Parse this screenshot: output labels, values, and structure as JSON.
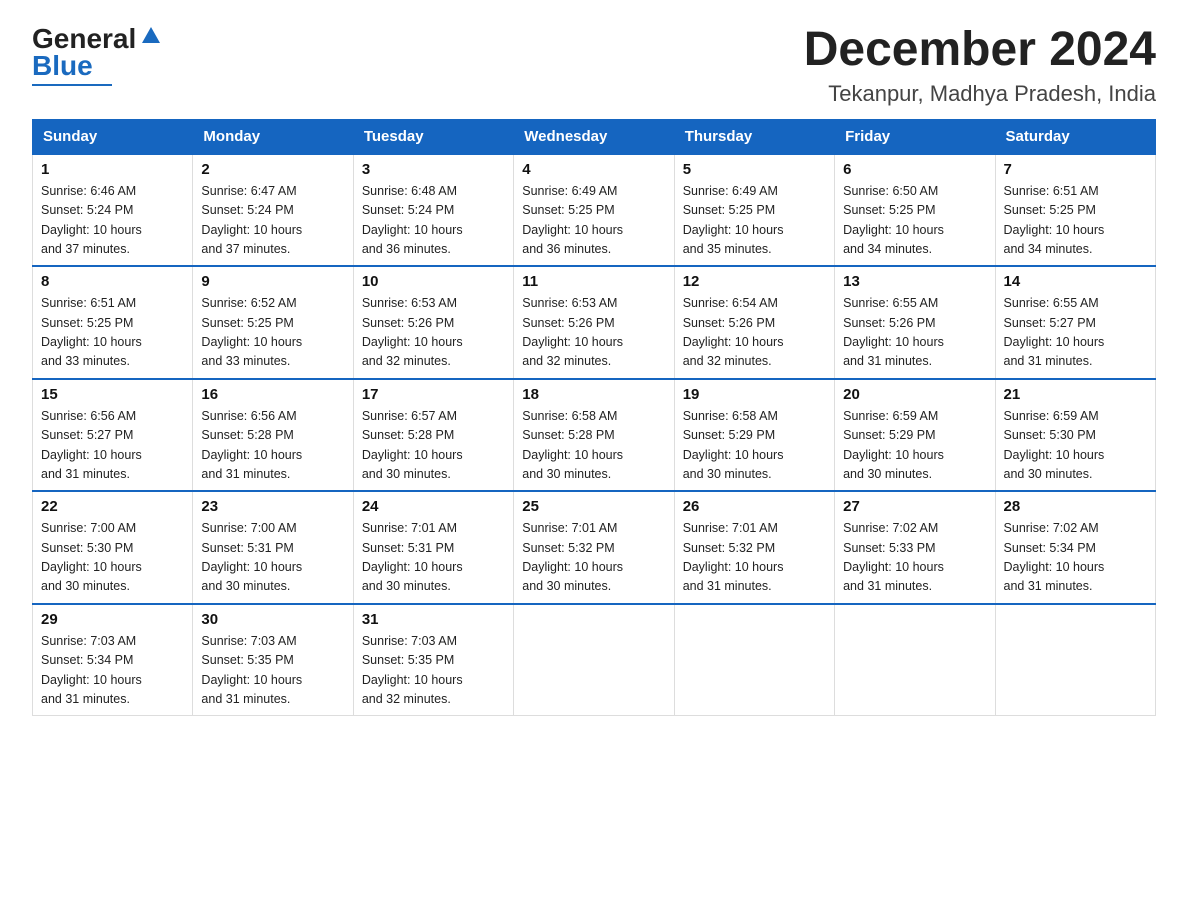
{
  "header": {
    "logo_general": "General",
    "logo_blue": "Blue",
    "title": "December 2024",
    "subtitle": "Tekanpur, Madhya Pradesh, India"
  },
  "days_of_week": [
    "Sunday",
    "Monday",
    "Tuesday",
    "Wednesday",
    "Thursday",
    "Friday",
    "Saturday"
  ],
  "weeks": [
    [
      {
        "day": "1",
        "sunrise": "6:46 AM",
        "sunset": "5:24 PM",
        "daylight": "10 hours and 37 minutes."
      },
      {
        "day": "2",
        "sunrise": "6:47 AM",
        "sunset": "5:24 PM",
        "daylight": "10 hours and 37 minutes."
      },
      {
        "day": "3",
        "sunrise": "6:48 AM",
        "sunset": "5:24 PM",
        "daylight": "10 hours and 36 minutes."
      },
      {
        "day": "4",
        "sunrise": "6:49 AM",
        "sunset": "5:25 PM",
        "daylight": "10 hours and 36 minutes."
      },
      {
        "day": "5",
        "sunrise": "6:49 AM",
        "sunset": "5:25 PM",
        "daylight": "10 hours and 35 minutes."
      },
      {
        "day": "6",
        "sunrise": "6:50 AM",
        "sunset": "5:25 PM",
        "daylight": "10 hours and 34 minutes."
      },
      {
        "day": "7",
        "sunrise": "6:51 AM",
        "sunset": "5:25 PM",
        "daylight": "10 hours and 34 minutes."
      }
    ],
    [
      {
        "day": "8",
        "sunrise": "6:51 AM",
        "sunset": "5:25 PM",
        "daylight": "10 hours and 33 minutes."
      },
      {
        "day": "9",
        "sunrise": "6:52 AM",
        "sunset": "5:25 PM",
        "daylight": "10 hours and 33 minutes."
      },
      {
        "day": "10",
        "sunrise": "6:53 AM",
        "sunset": "5:26 PM",
        "daylight": "10 hours and 32 minutes."
      },
      {
        "day": "11",
        "sunrise": "6:53 AM",
        "sunset": "5:26 PM",
        "daylight": "10 hours and 32 minutes."
      },
      {
        "day": "12",
        "sunrise": "6:54 AM",
        "sunset": "5:26 PM",
        "daylight": "10 hours and 32 minutes."
      },
      {
        "day": "13",
        "sunrise": "6:55 AM",
        "sunset": "5:26 PM",
        "daylight": "10 hours and 31 minutes."
      },
      {
        "day": "14",
        "sunrise": "6:55 AM",
        "sunset": "5:27 PM",
        "daylight": "10 hours and 31 minutes."
      }
    ],
    [
      {
        "day": "15",
        "sunrise": "6:56 AM",
        "sunset": "5:27 PM",
        "daylight": "10 hours and 31 minutes."
      },
      {
        "day": "16",
        "sunrise": "6:56 AM",
        "sunset": "5:28 PM",
        "daylight": "10 hours and 31 minutes."
      },
      {
        "day": "17",
        "sunrise": "6:57 AM",
        "sunset": "5:28 PM",
        "daylight": "10 hours and 30 minutes."
      },
      {
        "day": "18",
        "sunrise": "6:58 AM",
        "sunset": "5:28 PM",
        "daylight": "10 hours and 30 minutes."
      },
      {
        "day": "19",
        "sunrise": "6:58 AM",
        "sunset": "5:29 PM",
        "daylight": "10 hours and 30 minutes."
      },
      {
        "day": "20",
        "sunrise": "6:59 AM",
        "sunset": "5:29 PM",
        "daylight": "10 hours and 30 minutes."
      },
      {
        "day": "21",
        "sunrise": "6:59 AM",
        "sunset": "5:30 PM",
        "daylight": "10 hours and 30 minutes."
      }
    ],
    [
      {
        "day": "22",
        "sunrise": "7:00 AM",
        "sunset": "5:30 PM",
        "daylight": "10 hours and 30 minutes."
      },
      {
        "day": "23",
        "sunrise": "7:00 AM",
        "sunset": "5:31 PM",
        "daylight": "10 hours and 30 minutes."
      },
      {
        "day": "24",
        "sunrise": "7:01 AM",
        "sunset": "5:31 PM",
        "daylight": "10 hours and 30 minutes."
      },
      {
        "day": "25",
        "sunrise": "7:01 AM",
        "sunset": "5:32 PM",
        "daylight": "10 hours and 30 minutes."
      },
      {
        "day": "26",
        "sunrise": "7:01 AM",
        "sunset": "5:32 PM",
        "daylight": "10 hours and 31 minutes."
      },
      {
        "day": "27",
        "sunrise": "7:02 AM",
        "sunset": "5:33 PM",
        "daylight": "10 hours and 31 minutes."
      },
      {
        "day": "28",
        "sunrise": "7:02 AM",
        "sunset": "5:34 PM",
        "daylight": "10 hours and 31 minutes."
      }
    ],
    [
      {
        "day": "29",
        "sunrise": "7:03 AM",
        "sunset": "5:34 PM",
        "daylight": "10 hours and 31 minutes."
      },
      {
        "day": "30",
        "sunrise": "7:03 AM",
        "sunset": "5:35 PM",
        "daylight": "10 hours and 31 minutes."
      },
      {
        "day": "31",
        "sunrise": "7:03 AM",
        "sunset": "5:35 PM",
        "daylight": "10 hours and 32 minutes."
      },
      null,
      null,
      null,
      null
    ]
  ],
  "labels": {
    "sunrise": "Sunrise:",
    "sunset": "Sunset:",
    "daylight": "Daylight:"
  }
}
